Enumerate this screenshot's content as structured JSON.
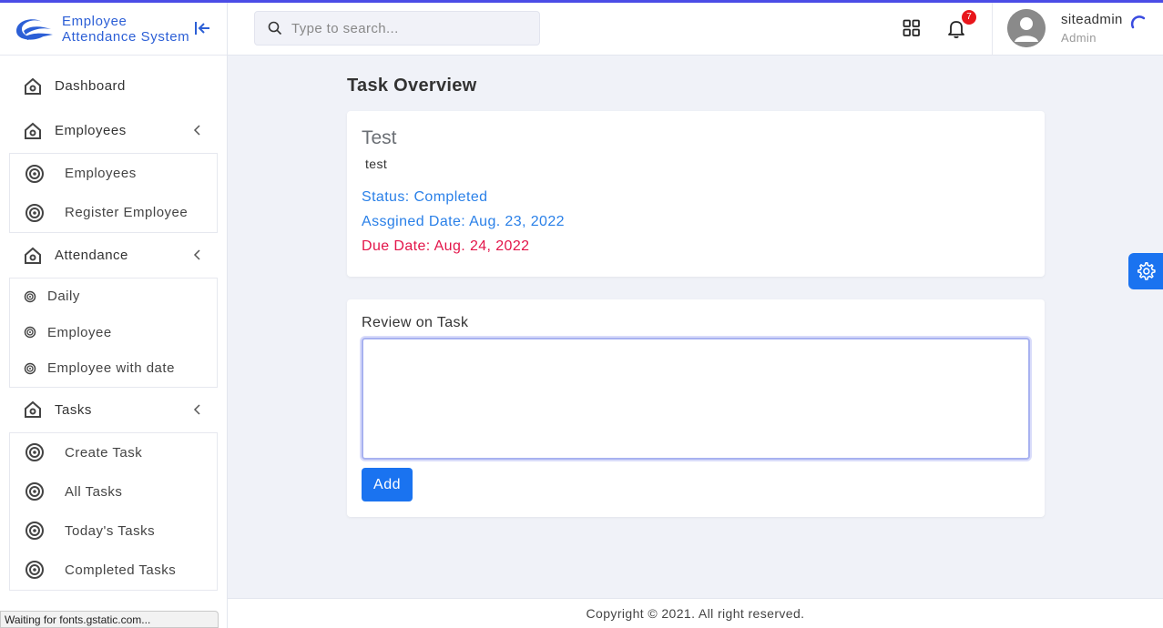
{
  "app": {
    "brand_line1": "Employee",
    "brand_line2": "Attendance System",
    "accent_color": "#1a73f0"
  },
  "sidebar": {
    "items": [
      {
        "label": "Dashboard",
        "icon": "home-icon"
      },
      {
        "label": "Employees",
        "icon": "home-icon",
        "expanded": true,
        "children": [
          {
            "label": "Employees"
          },
          {
            "label": "Register Employee"
          }
        ]
      },
      {
        "label": "Attendance",
        "icon": "home-icon",
        "expanded": true,
        "children": [
          {
            "label": "Daily"
          },
          {
            "label": "Employee"
          },
          {
            "label": "Employee with date"
          }
        ]
      },
      {
        "label": "Tasks",
        "icon": "home-icon",
        "expanded": true,
        "children": [
          {
            "label": "Create Task"
          },
          {
            "label": "All Tasks"
          },
          {
            "label": "Today's Tasks"
          },
          {
            "label": "Completed Tasks"
          }
        ]
      }
    ]
  },
  "header": {
    "search_placeholder": "Type to search...",
    "notification_count": "7",
    "user_name": "siteadmin",
    "user_role": "Admin"
  },
  "main": {
    "page_title": "Task Overview",
    "task": {
      "title": "Test",
      "description": "test",
      "status": "Status: Completed",
      "assigned": "Assgined Date: Aug. 23, 2022",
      "due": "Due Date: Aug. 24, 2022"
    },
    "review": {
      "label": "Review on Task",
      "value": "",
      "add_label": "Add"
    }
  },
  "footer": {
    "text": "Copyright © 2021. All right reserved."
  },
  "browser_status": "Waiting for fonts.gstatic.com..."
}
